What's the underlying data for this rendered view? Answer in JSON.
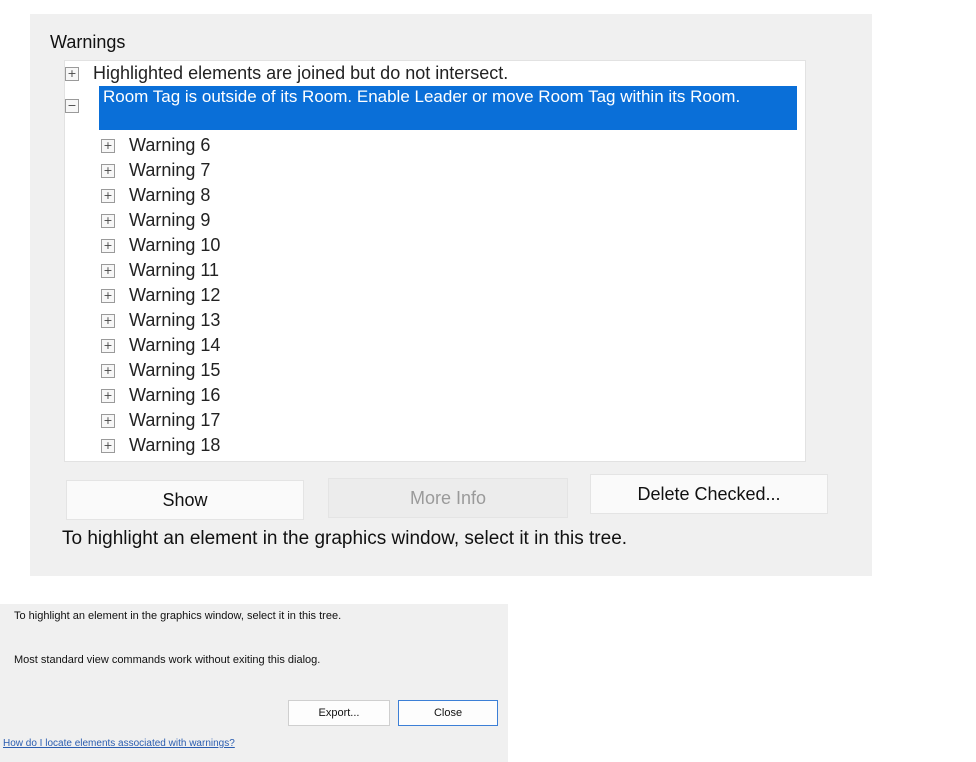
{
  "upper_dialog": {
    "section_title": "Warnings",
    "tree": {
      "collapsed_item": "Highlighted elements are joined but do not intersect.",
      "selected_item": "Room Tag is outside of its Room.  Enable Leader or move Room Tag within its Room.",
      "children": [
        "Warning 6",
        "Warning 7",
        "Warning 8",
        "Warning 9",
        "Warning 10",
        "Warning 11",
        "Warning 12",
        "Warning 13",
        "Warning 14",
        "Warning 15",
        "Warning 16",
        "Warning 17",
        "Warning 18"
      ],
      "expand_glyph": "+",
      "collapse_glyph": "−"
    },
    "buttons": {
      "show": "Show",
      "more_info": "More Info",
      "delete_checked": "Delete Checked..."
    },
    "hint": "To highlight an element in the graphics window, select it in this tree."
  },
  "lower_dialog": {
    "line1": "To highlight an element in the graphics window, select it in this tree.",
    "line2": "Most standard view commands work without exiting this dialog.",
    "buttons": {
      "export": "Export...",
      "close": "Close"
    },
    "help_link": "How do I locate elements associated with warnings?"
  },
  "colors": {
    "selection": "#0a6fd8",
    "dialog_bg": "#f0f0f0",
    "link": "#2a5db0"
  }
}
